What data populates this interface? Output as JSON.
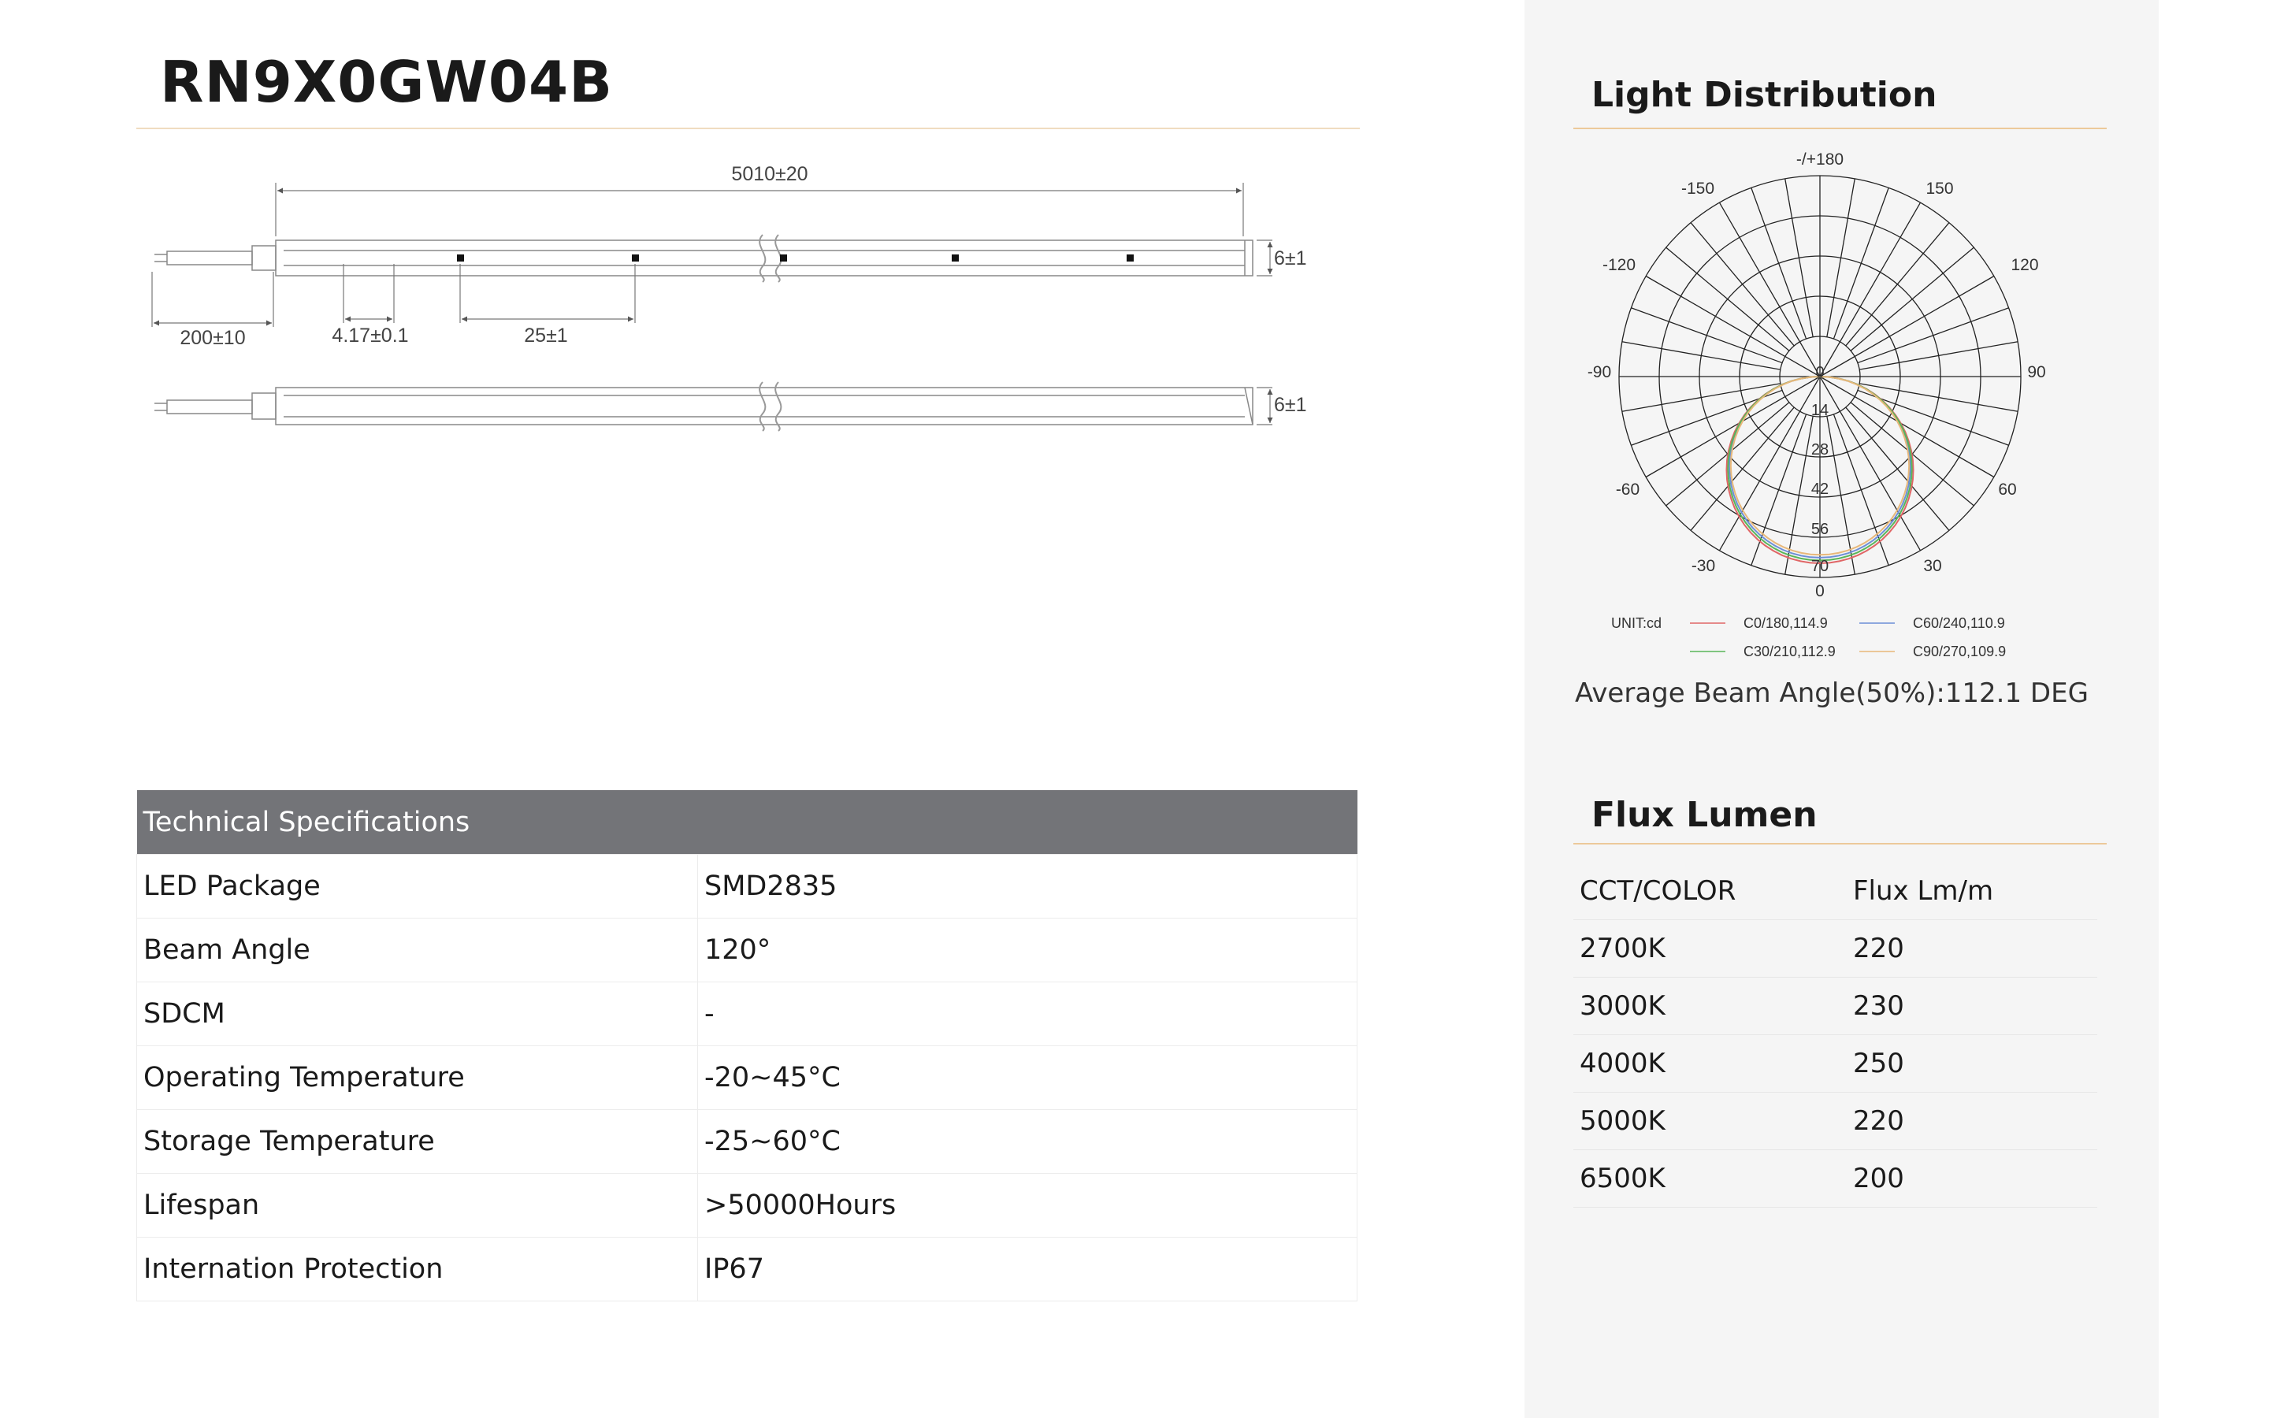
{
  "product": {
    "code": "RN9X0GW04B"
  },
  "drawing": {
    "length_dim": "5010±20",
    "height_dim_top": "6±1",
    "height_dim_bottom": "6±1",
    "cable_dim": "200±10",
    "pitch_dim": "4.17±0.1",
    "cut_dim": "25±1"
  },
  "specs": {
    "header": "Technical Specifications",
    "rows": [
      {
        "label": "LED Package",
        "value": "SMD2835"
      },
      {
        "label": "Beam Angle",
        "value": "120°"
      },
      {
        "label": "SDCM",
        "value": "-"
      },
      {
        "label": "Operating Temperature",
        "value": "-20~45°C"
      },
      {
        "label": "Storage Temperature",
        "value": "-25~60°C"
      },
      {
        "label": "Lifespan",
        "value": ">50000Hours"
      },
      {
        "label": "Internation Protection",
        "value": "IP67"
      }
    ]
  },
  "light_distribution": {
    "title": "Light Distribution",
    "angle_labels": [
      "-/+180",
      "150",
      "120",
      "90",
      "60",
      "30",
      "0",
      "-30",
      "-60",
      "-90",
      "-120",
      "-150"
    ],
    "radial_labels": [
      "0",
      "14",
      "28",
      "42",
      "56",
      "70"
    ],
    "unit": "UNIT:cd",
    "legend": [
      {
        "name": "C0/180,114.9",
        "color": "#e06666"
      },
      {
        "name": "C60/240,110.9",
        "color": "#6d8fd6"
      },
      {
        "name": "C30/210,112.9",
        "color": "#5ab55a"
      },
      {
        "name": "C90/270,109.9",
        "color": "#e8b87a"
      }
    ],
    "beam_note": "Average Beam Angle(50%):112.1 DEG"
  },
  "flux": {
    "title": "Flux Lumen",
    "headers": [
      "CCT/COLOR",
      "Flux Lm/m"
    ],
    "rows": [
      {
        "cct": "2700K",
        "flux": "220"
      },
      {
        "cct": "3000K",
        "flux": "230"
      },
      {
        "cct": "4000K",
        "flux": "250"
      },
      {
        "cct": "5000K",
        "flux": "220"
      },
      {
        "cct": "6500K",
        "flux": "200"
      }
    ]
  }
}
